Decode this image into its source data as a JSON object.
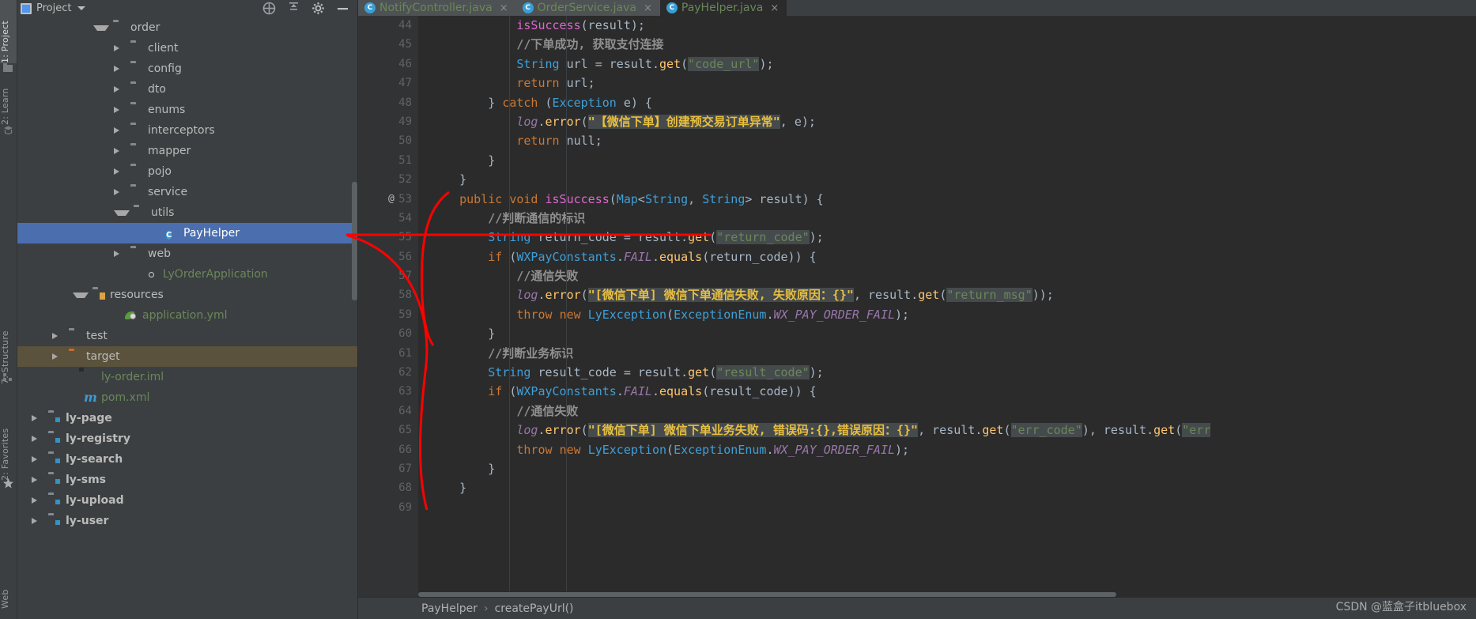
{
  "app": {
    "theme_bg": "#3c3f41",
    "editor_bg": "#2b2b2b",
    "accent_selection": "#4b6eaf",
    "annotation_color": "#ff0000",
    "watermark": "CSDN @蓝盒子itbluebox"
  },
  "left_strip": {
    "items": [
      {
        "label": "1: Project",
        "selected": true
      },
      {
        "label": "2: Learn"
      },
      {
        "label": "7: Structure"
      },
      {
        "label": "2: Favorites"
      }
    ]
  },
  "project_panel": {
    "title": "Project",
    "icons": [
      "project-square-icon",
      "chevron-down-icon",
      "collapse-all-icon",
      "hide-icon",
      "gear-icon",
      "minimize-icon"
    ],
    "tree": [
      {
        "label": "order",
        "indent": 3,
        "state": "open",
        "icon": "package-folder",
        "style": "normal"
      },
      {
        "label": "client",
        "indent": 4,
        "state": "closed",
        "icon": "package-folder",
        "style": "normal"
      },
      {
        "label": "config",
        "indent": 4,
        "state": "closed",
        "icon": "package-folder",
        "style": "normal"
      },
      {
        "label": "dto",
        "indent": 4,
        "state": "closed",
        "icon": "package-folder",
        "style": "normal"
      },
      {
        "label": "enums",
        "indent": 4,
        "state": "closed",
        "icon": "package-folder",
        "style": "normal"
      },
      {
        "label": "interceptors",
        "indent": 4,
        "state": "closed",
        "icon": "package-folder",
        "style": "normal"
      },
      {
        "label": "mapper",
        "indent": 4,
        "state": "closed",
        "icon": "package-folder",
        "style": "normal"
      },
      {
        "label": "pojo",
        "indent": 4,
        "state": "closed",
        "icon": "package-folder",
        "style": "normal"
      },
      {
        "label": "service",
        "indent": 4,
        "state": "closed",
        "icon": "package-folder",
        "style": "normal"
      },
      {
        "label": "utils",
        "indent": 4,
        "state": "open",
        "icon": "package-folder",
        "style": "normal"
      },
      {
        "label": "PayHelper",
        "indent": 6,
        "state": "leaf",
        "icon": "java-class",
        "style": "selected"
      },
      {
        "label": "web",
        "indent": 4,
        "state": "closed",
        "icon": "package-folder",
        "style": "normal"
      },
      {
        "label": "LyOrderApplication",
        "indent": 5,
        "state": "leaf",
        "icon": "spring-boot-class",
        "style": "green"
      },
      {
        "label": "resources",
        "indent": 2,
        "state": "open",
        "icon": "resources-folder",
        "style": "normal"
      },
      {
        "label": "application.yml",
        "indent": 4,
        "state": "leaf",
        "icon": "spring-yaml",
        "style": "green"
      },
      {
        "label": "test",
        "indent": 1,
        "state": "closed",
        "icon": "plain-folder",
        "style": "normal"
      },
      {
        "label": "target",
        "indent": 1,
        "state": "closed",
        "icon": "excluded-folder",
        "style": "highlighted"
      },
      {
        "label": "ly-order.iml",
        "indent": 2,
        "state": "leaf",
        "icon": "iml-file",
        "style": "green"
      },
      {
        "label": "pom.xml",
        "indent": 2,
        "state": "leaf",
        "icon": "maven-file",
        "style": "green"
      },
      {
        "label": "ly-page",
        "indent": 0,
        "state": "closed",
        "icon": "module-folder",
        "style": "bold"
      },
      {
        "label": "ly-registry",
        "indent": 0,
        "state": "closed",
        "icon": "module-folder",
        "style": "bold"
      },
      {
        "label": "ly-search",
        "indent": 0,
        "state": "closed",
        "icon": "module-folder",
        "style": "bold"
      },
      {
        "label": "ly-sms",
        "indent": 0,
        "state": "closed",
        "icon": "module-folder",
        "style": "bold"
      },
      {
        "label": "ly-upload",
        "indent": 0,
        "state": "closed",
        "icon": "module-folder",
        "style": "bold"
      },
      {
        "label": "ly-user",
        "indent": 0,
        "state": "closed",
        "icon": "module-folder",
        "style": "bold"
      }
    ]
  },
  "editor": {
    "tabs": [
      {
        "label": "NotifyController.java",
        "active": false,
        "close": "×"
      },
      {
        "label": "OrderService.java",
        "active": false,
        "close": "×"
      },
      {
        "label": "PayHelper.java",
        "active": true,
        "close": "×"
      }
    ],
    "first_line_number": 44,
    "lines": [
      {
        "n": 44,
        "marker": "",
        "fold": "",
        "text": "            isSuccess(result);"
      },
      {
        "n": 45,
        "marker": "",
        "fold": "",
        "text": "            //下单成功, 获取支付连接"
      },
      {
        "n": 46,
        "marker": "",
        "fold": "",
        "text": "            String url = result.get(\"code_url\");"
      },
      {
        "n": 47,
        "marker": "",
        "fold": "",
        "text": "            return url;"
      },
      {
        "n": 48,
        "marker": "",
        "fold": "down",
        "text": "        } catch (Exception e) {"
      },
      {
        "n": 49,
        "marker": "",
        "fold": "",
        "text": "            log.error(\"【微信下单】创建预交易订单异常\", e);"
      },
      {
        "n": 50,
        "marker": "",
        "fold": "",
        "text": "            return null;"
      },
      {
        "n": 51,
        "marker": "",
        "fold": "up",
        "text": "        }"
      },
      {
        "n": 52,
        "marker": "",
        "fold": "up",
        "text": "    }"
      },
      {
        "n": 53,
        "marker": "@",
        "fold": "down",
        "text": "    public void isSuccess(Map<String, String> result) {"
      },
      {
        "n": 54,
        "marker": "",
        "fold": "",
        "text": "        //判断通信的标识"
      },
      {
        "n": 55,
        "marker": "",
        "fold": "",
        "text": "        String return_code = result.get(\"return_code\");"
      },
      {
        "n": 56,
        "marker": "",
        "fold": "down",
        "text": "        if (WXPayConstants.FAIL.equals(return_code)) {"
      },
      {
        "n": 57,
        "marker": "",
        "fold": "",
        "text": "            //通信失败"
      },
      {
        "n": 58,
        "marker": "",
        "fold": "",
        "text": "            log.error(\"[微信下单] 微信下单通信失败, 失败原因：{}\", result.get(\"return_msg\"));"
      },
      {
        "n": 59,
        "marker": "",
        "fold": "",
        "text": "            throw new LyException(ExceptionEnum.WX_PAY_ORDER_FAIL);"
      },
      {
        "n": 60,
        "marker": "",
        "fold": "up",
        "text": "        }"
      },
      {
        "n": 61,
        "marker": "",
        "fold": "",
        "text": "        //判断业务标识"
      },
      {
        "n": 62,
        "marker": "",
        "fold": "",
        "text": "        String result_code = result.get(\"result_code\");"
      },
      {
        "n": 63,
        "marker": "",
        "fold": "down",
        "text": "        if (WXPayConstants.FAIL.equals(result_code)) {"
      },
      {
        "n": 64,
        "marker": "",
        "fold": "",
        "text": "            //通信失败"
      },
      {
        "n": 65,
        "marker": "",
        "fold": "",
        "text": "            log.error(\"[微信下单] 微信下单业务失败, 错误码:{},错误原因：{}\", result.get(\"err_code\"), result.get(\"err"
      },
      {
        "n": 66,
        "marker": "",
        "fold": "",
        "text": "            throw new LyException(ExceptionEnum.WX_PAY_ORDER_FAIL);"
      },
      {
        "n": 67,
        "marker": "",
        "fold": "up",
        "text": "        }"
      },
      {
        "n": 68,
        "marker": "",
        "fold": "up",
        "text": "    }"
      },
      {
        "n": 69,
        "marker": "",
        "fold": "",
        "text": ""
      }
    ],
    "breadcrumb": {
      "class": "PayHelper",
      "separator": "›",
      "method": "createPayUrl()"
    }
  }
}
